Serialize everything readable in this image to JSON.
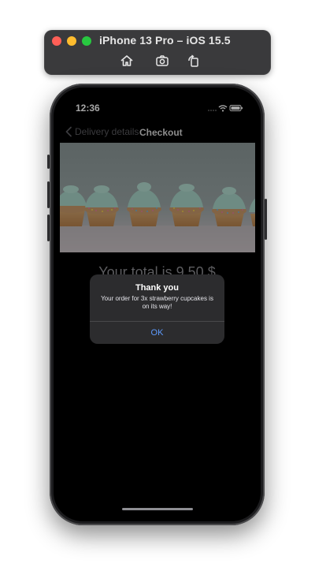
{
  "simulator": {
    "title": "iPhone 13 Pro – iOS 15.5",
    "tools": [
      "home-icon",
      "screenshot-icon",
      "rotate-icon"
    ]
  },
  "status_bar": {
    "time": "12:36"
  },
  "nav": {
    "back_label": "Delivery details",
    "title": "Checkout"
  },
  "content": {
    "total_text": "Your total is 9.50 $"
  },
  "alert": {
    "title": "Thank you",
    "message": "Your order for 3x strawberry cupcakes is on its way!",
    "ok_label": "OK"
  },
  "colors": {
    "accent": "#5e9cff",
    "alert_bg": "#2c2c2e",
    "screen_bg": "#000000"
  }
}
